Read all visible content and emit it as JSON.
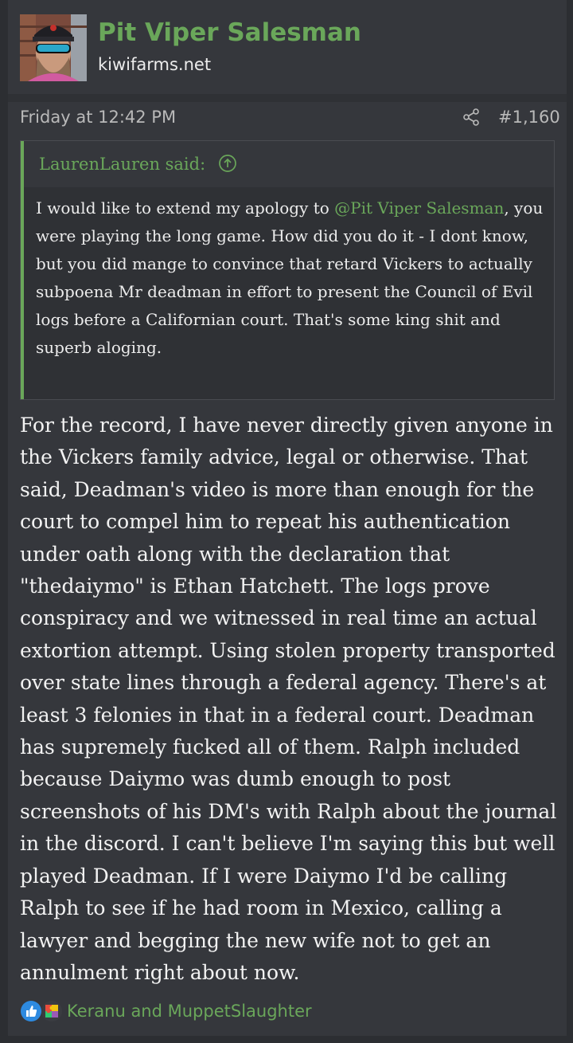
{
  "colors": {
    "accent": "#6aa75a",
    "background": "#2c2e32",
    "card": "#35373c",
    "text": "#ececec",
    "muted": "#b9b9b9"
  },
  "post": {
    "author": {
      "name": "Pit Viper Salesman",
      "title": "kiwifarms.net",
      "avatar_icon": "user-avatar"
    },
    "date": "Friday at 12:42 PM",
    "share_icon": "share-icon",
    "number": "#1,160",
    "quote": {
      "author_label": "LaurenLauren said:",
      "jump_icon": "arrow-up-circle-icon",
      "text_before_mention": "I would like to extend my apology to ",
      "mention": "@Pit Viper Salesman",
      "text_after_mention": ", you were playing the long game. How did you do it - I dont know, but you did mange to convince that retard Vickers to actually subpoena Mr deadman in effort to present the Council of Evil logs before a Californian court. That's some king shit and superb aloging."
    },
    "body": "For the record, I have never directly given anyone in the Vickers family advice, legal or otherwise. That said, Deadman's video is more than enough for the court to compel him to repeat his authentication under oath along with the declaration that \"thedaiymo\" is Ethan Hatchett. The logs prove conspiracy and we witnessed in real time an actual extortion attempt. Using stolen property transported over state lines through a federal agency. There's at least 3 felonies in that in a federal court. Deadman has supremely fucked all of them. Ralph included because Daiymo was dumb enough to post screenshots of his DM's with Ralph about the journal in the discord. I can't believe I'm saying this but well played Deadman. If I were Daiymo I'd be calling Ralph to see if he had room in Mexico, calling a lawyer and begging the new wife not to get an annulment right about now.",
    "reactions": {
      "icons": [
        "like-icon",
        "puzzle-icon"
      ],
      "names": "Keranu and MuppetSlaughter"
    }
  }
}
